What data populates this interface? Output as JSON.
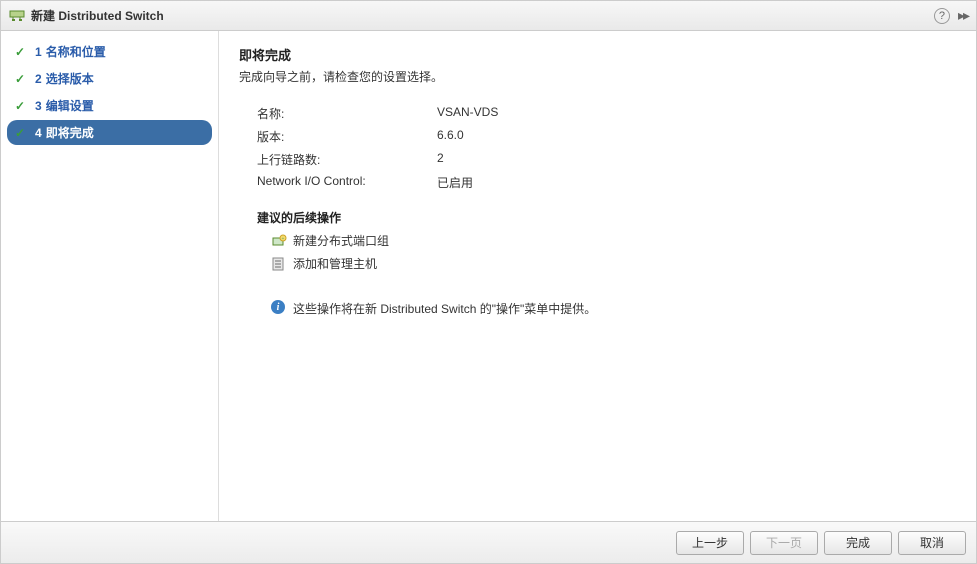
{
  "titlebar": {
    "title": "新建 Distributed Switch"
  },
  "steps": [
    {
      "num": "1",
      "label": "名称和位置",
      "done": true
    },
    {
      "num": "2",
      "label": "选择版本",
      "done": true
    },
    {
      "num": "3",
      "label": "编辑设置",
      "done": true
    },
    {
      "num": "4",
      "label": "即将完成",
      "current": true,
      "done": true
    }
  ],
  "content": {
    "heading": "即将完成",
    "subtitle": "完成向导之前，请检查您的设置选择。",
    "summary": [
      {
        "k": "名称:",
        "v": "VSAN-VDS"
      },
      {
        "k": "版本:",
        "v": "6.6.0"
      },
      {
        "k": "上行链路数:",
        "v": "2"
      },
      {
        "k": "Network I/O Control:",
        "v": "已启用"
      }
    ],
    "actions_title": "建议的后续操作",
    "actions": [
      {
        "icon": "portgroup",
        "label": "新建分布式端口组"
      },
      {
        "icon": "hosts",
        "label": "添加和管理主机"
      }
    ],
    "info": "这些操作将在新 Distributed Switch 的\"操作\"菜单中提供。"
  },
  "footer": {
    "back": "上一步",
    "next": "下一页",
    "finish": "完成",
    "cancel": "取消"
  }
}
